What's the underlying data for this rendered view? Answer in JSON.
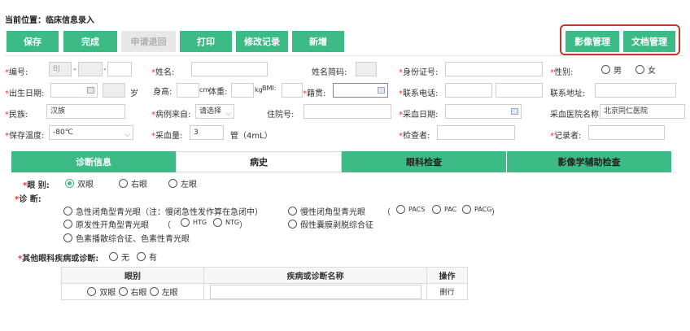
{
  "breadcrumb": "当前位置：临床信息录入",
  "toolbar": {
    "save": "保存",
    "finish": "完成",
    "return_request": "申请退回",
    "print": "打印",
    "edit_log": "修改记录",
    "add": "新增",
    "image_mgmt": "影像管理",
    "doc_mgmt": "文档管理"
  },
  "form": {
    "id_label": "编号:",
    "id_value": "BJ",
    "name_label": "姓名:",
    "abbr_label": "姓名简码:",
    "idcard_label": "身份证号:",
    "gender_label": "性别:",
    "gender_male": "男",
    "gender_female": "女",
    "dob_label": "出生日期:",
    "age_unit": "岁",
    "height_label": "身高:",
    "height_unit": "cm",
    "weight_label": "体重:",
    "weight_unit": "kg",
    "bmi_label": "BMI:",
    "origin_label": "籍贯:",
    "phone_label": "联系电话:",
    "address_label": "联系地址:",
    "ethnicity_label": "民族:",
    "ethnicity_value": "汉族",
    "source_label": "病例来自:",
    "source_value": "请选择",
    "admission_label": "住院号:",
    "collect_date_label": "采血日期:",
    "hospital_label": "采血医院名称:",
    "hospital_value": "北京同仁医院",
    "temp_label": "保存温度:",
    "temp_value": "-80℃",
    "volume_label": "采血量:",
    "volume_value": "3",
    "volume_unit": "管（4mL）",
    "checker_label": "检查者:",
    "recorder_label": "记录者:"
  },
  "tabs": [
    "诊断信息",
    "病史",
    "眼科检查",
    "影像学辅助检查"
  ],
  "diagnosis": {
    "eye_label": "眼 别:",
    "eye_options": [
      "双眼",
      "右眼",
      "左眼"
    ],
    "diag_label": "诊 断:",
    "acute": "急性闭角型青光眼（注：慢闭急性发作算在急闭中）",
    "chronic": "慢性闭角型青光眼",
    "chronic_opts": [
      "PACS",
      "PAC",
      "PACG"
    ],
    "primary_open": "原发性开角型青光眼",
    "open_opts": [
      "HTG",
      "NTG"
    ],
    "pseudo": "假性囊膜剥脱综合征",
    "pigment": "色素播散综合征、色素性青光眼",
    "other_label": "其他眼科疾病或诊断:",
    "other_no": "无",
    "other_yes": "有"
  },
  "table": {
    "headers": [
      "眼别",
      "疾病或诊断名称",
      "操作"
    ],
    "row_eyes": [
      "双眼",
      "右眼",
      "左眼"
    ],
    "row_action": "删行"
  },
  "colors": {
    "accent": "#3dbb86",
    "required": "#e4393c",
    "highlight": "#c0392b"
  }
}
